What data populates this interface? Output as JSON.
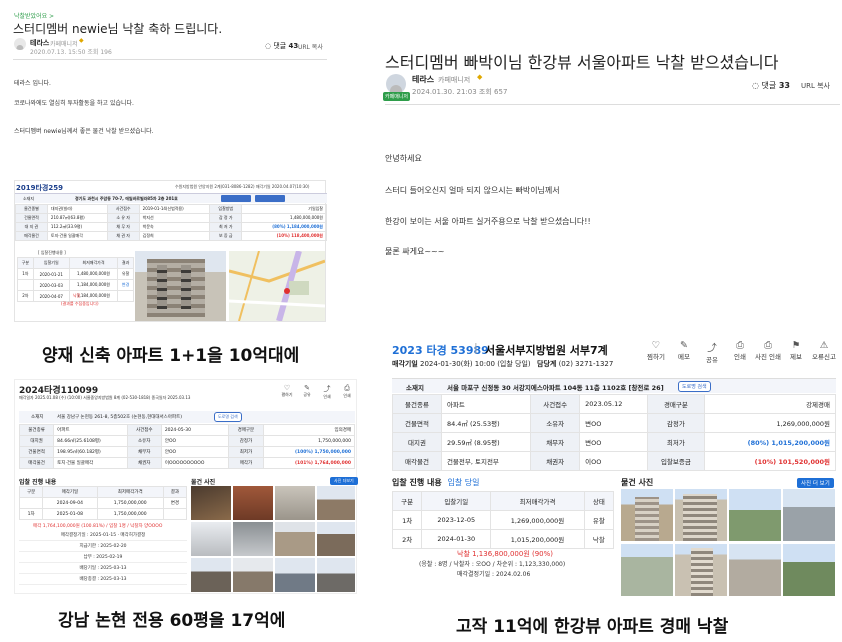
{
  "tl": {
    "breadcrumb": "낙찰받았어요 >",
    "title": "스터디멤버 newie님 낙찰 축하 드립니다.",
    "author": "테라스",
    "role": "카페매니저",
    "meta": "2020.07.13. 15:50  조회 196",
    "comment_label": "댓글",
    "comment_count": "43",
    "url_copy": "URL 복사",
    "body": [
      "테라스 입니다.",
      "코로나와에도 열심히 투자활동을 하고 있습니다.",
      "스터디멤버 newie님께서 좋은 물건 낙찰 받으셨습니다."
    ],
    "case_year": "2019타경259",
    "court_line": "수원지방법원 안양지원 2계(031-8086-1282) 매각기일 2020.04.07(10:30)",
    "location_label": "소재지",
    "location_value": "경기도 과천시 주암동 70-7, 애일바르빌라85차 2층 201호",
    "info_rows": [
      [
        "물건종별",
        "대지권(빌라)",
        "사건접수",
        "2019-01-14(신법적용)",
        "입찰방법",
        "기일입찰"
      ],
      [
        "건물면적",
        "210.87㎡(63.8평)",
        "소 유 자",
        "박지선",
        "감 정 가",
        "1,480,000,000원"
      ],
      [
        "대 지 권",
        "112.2㎡(33.9평)",
        "채 무 자",
        "박문숙",
        "최 저 가",
        "(80%) 1,184,000,000원"
      ],
      [
        "매각물건",
        "토지·건물 일괄매각",
        "채 권 자",
        "김정희",
        "보 증 금",
        "(10%) 118,400,000원"
      ]
    ],
    "progress_title": "[ 입찰진행내용 ]",
    "progress_head": [
      "구분",
      "입찰기일",
      "최저매각가격",
      "결과"
    ],
    "progress_rows": [
      [
        "1차",
        "2020-01-21",
        "1,480,000,000원",
        "유찰"
      ],
      [
        "",
        "2020-03-03",
        "1,184,000,000원",
        "변경"
      ],
      [
        "2차",
        "2020-04-07",
        "1,184,000,000원",
        ""
      ]
    ],
    "result1": "낙찰",
    "result2": "(결과를 수집중입니다)"
  },
  "cap_tl": "양재 신축 아파트 1+1을 10억대에",
  "tr": {
    "title": "스터디멤버 빠박이님 한강뷰 서울아파트 낙찰 받으셨습니다",
    "author": "테라스",
    "role": "카페매니저",
    "meta": "2024.01.30. 21:03  조회 657",
    "badge": "카페매니저",
    "comment_label": "댓글",
    "comment_count": "33",
    "url_copy": "URL 복사",
    "body": [
      "안녕하세요",
      "스터디 들어오신지 얼마 되지 않으시는 빠박이님께서",
      "한강이 보이는 서울 아파트 실거주용으로 낙찰 받으셨습니다!!",
      "물론 싸게요~~~"
    ]
  },
  "bl": {
    "case": "2024타경110099",
    "sub": "매각일자 2025.01.08 (수) (10:00) 서울중앙지방법원 8계 (02-530-1818) 종국일자 2025.03.13",
    "actions": [
      "평하기",
      "공유",
      "인쇄",
      "인쇄"
    ],
    "location_label": "소재지",
    "location_value": "서울 강남구 논현동 261-8, 5층502호 (논현동,현대대서스아파트)",
    "loc_btn": "도로명 검색",
    "rows": [
      [
        "물건종류",
        "아파트",
        "사건접수",
        "2024-05-30",
        "경매구분",
        "임의경매"
      ],
      [
        "대지권",
        "84.66㎡(25.6108평)",
        "소유자",
        "안OO",
        "감정가",
        "1,750,000,000"
      ],
      [
        "건물면적",
        "198.95㎡(60.182평)",
        "채무자",
        "안OO",
        "최저가",
        "(100%) 1,750,000,000"
      ],
      [
        "매각물건",
        "토지·건물 일괄매각",
        "채권자",
        "이OOOOOOOOOO",
        "매각가",
        "(101%) 1,764,000,000"
      ]
    ],
    "progress_title": "입찰 진행 내용",
    "photos_title": "물건 사진",
    "photos_btn": "사진 더보기",
    "progress_head": [
      "구분",
      "매각기일",
      "최저매각가격",
      "결과"
    ],
    "progress_rows": [
      [
        "",
        "2024-09-04",
        "1,750,000,000",
        "변경"
      ],
      [
        "1차",
        "2025-01-08",
        "1,750,000,000",
        ""
      ]
    ],
    "sold_line": "매각 1,764,100,000원 (100.81%) / 입찰 1명 / 낙찰자 양OOOO",
    "notes": [
      "매각결정기일 : 2025-01-15 · 매각허가결정",
      "지급기한 : 2025-02-20",
      "납부 : 2025-02-19",
      "배당기일 : 2025-03-13",
      "배당종결 : 2025-03-13"
    ]
  },
  "cap_bl": "강남 논현 전용 60평을 17억에",
  "br": {
    "case": "2023 타경 53989",
    "court": "서울서부지방법원 서부7계",
    "sale_label": "매각기일",
    "sale_value": "2024-01-30(화) 10:00 (입찰 당일)",
    "manager_label": "담당계",
    "manager_value": "(02) 3271-1327",
    "actions": [
      "찜하기",
      "메모",
      "공유",
      "인쇄",
      "사진 인쇄",
      "제보",
      "오류신고"
    ],
    "location_label": "소재지",
    "location_value": "서울 마포구 신정동 30 서강지에스아파트 104동 11층 1102호 [창전로 26]",
    "loc_btn": "도로명 검색",
    "rows": [
      [
        "물건종류",
        "아파트",
        "사건접수",
        "2023.05.12",
        "경매구분",
        "강제경매"
      ],
      [
        "건물면적",
        "84.4㎡ (25.53평)",
        "소유자",
        "변OO",
        "감정가",
        "1,269,000,000원"
      ],
      [
        "대지권",
        "29.59㎡ (8.95평)",
        "채무자",
        "변OO",
        "최저가",
        "(80%) 1,015,200,000원"
      ],
      [
        "매각물건",
        "건물전부, 토지전부",
        "채권자",
        "이OO",
        "입찰보증금",
        "(10%) 101,520,000원"
      ]
    ],
    "progress_title": "입찰 진행 내용",
    "progress_link": "입찰 당일",
    "photos_title": "물건 사진",
    "photos_btn": "사진 더 보기",
    "progress_head": [
      "구분",
      "입찰기일",
      "최저매각가격",
      "상태"
    ],
    "progress_rows": [
      [
        "1차",
        "2023-12-05",
        "1,269,000,000원",
        "유찰"
      ],
      [
        "2차",
        "2024-01-30",
        "1,015,200,000원",
        "낙찰"
      ]
    ],
    "sold_line": "낙찰 1,136,800,000원 (90%)",
    "bid_line": "(응찰 : 8명 / 낙찰자 : 오OO / 차순위 : 1,123,330,000)",
    "decision_line": "매각결정기일 : 2024.02.06"
  },
  "cap_br": "고작 11억에 한강뷰 아파트 경매 낙찰",
  "colors": {
    "accent_blue": "#1e6fd6",
    "red": "#e03030",
    "manager_green": "#2e9d4a"
  }
}
